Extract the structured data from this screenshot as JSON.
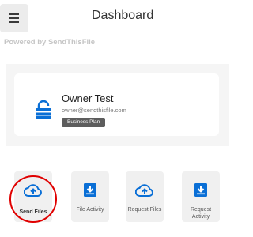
{
  "header": {
    "title": "Dashboard",
    "menu_icon": "hamburger-menu-icon"
  },
  "powered_by": "Powered by SendThisFile",
  "account": {
    "name": "Owner Test",
    "email": "owner@sendthisfile.com",
    "plan": "Business Plan",
    "lock_icon": "lock-icon",
    "accent": "#0a6fd6"
  },
  "actions": [
    {
      "label": "Send Files",
      "icon": "cloud-upload-icon"
    },
    {
      "label": "File Activity",
      "icon": "download-box-icon"
    },
    {
      "label": "Request Files",
      "icon": "cloud-upload-icon"
    },
    {
      "label": "Request Activity",
      "icon": "download-box-icon"
    }
  ],
  "colors": {
    "icon": "#0a6fd6",
    "highlight": "#e00000",
    "badge": "#5d5d5d"
  }
}
